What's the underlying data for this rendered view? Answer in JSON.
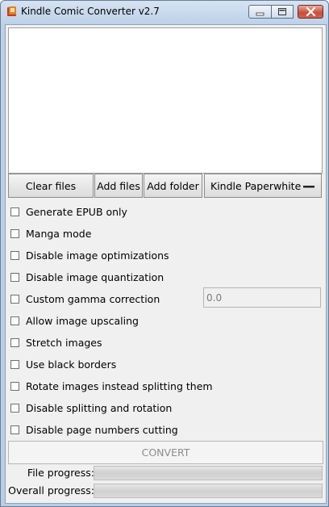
{
  "window": {
    "title": "Kindle Comic Converter v2.7",
    "icons": {
      "app": "kcc-app-icon",
      "minimize": "minimize-icon",
      "maximize": "maximize-icon",
      "close": "close-icon"
    }
  },
  "toolbar": {
    "clear_files": "Clear files",
    "add_files": "Add files",
    "add_folder": "Add folder",
    "device": "Kindle Paperwhite"
  },
  "options": [
    {
      "label": "Generate EPUB only",
      "checked": false
    },
    {
      "label": "Manga mode",
      "checked": false
    },
    {
      "label": "Disable image optimizations",
      "checked": false
    },
    {
      "label": "Disable image quantization",
      "checked": false
    },
    {
      "label": "Custom gamma correction",
      "checked": false
    },
    {
      "label": "Allow image upscaling",
      "checked": false
    },
    {
      "label": "Stretch images",
      "checked": false
    },
    {
      "label": "Use black borders",
      "checked": false
    },
    {
      "label": "Rotate images instead splitting them",
      "checked": false
    },
    {
      "label": "Disable splitting and rotation",
      "checked": false
    },
    {
      "label": "Disable page numbers cutting",
      "checked": false
    }
  ],
  "gamma": {
    "value": "0.0"
  },
  "convert_label": "CONVERT",
  "progress": {
    "file_label": "File progress:",
    "file_value": 0,
    "overall_label": "Overall progress:",
    "overall_value": 0
  }
}
